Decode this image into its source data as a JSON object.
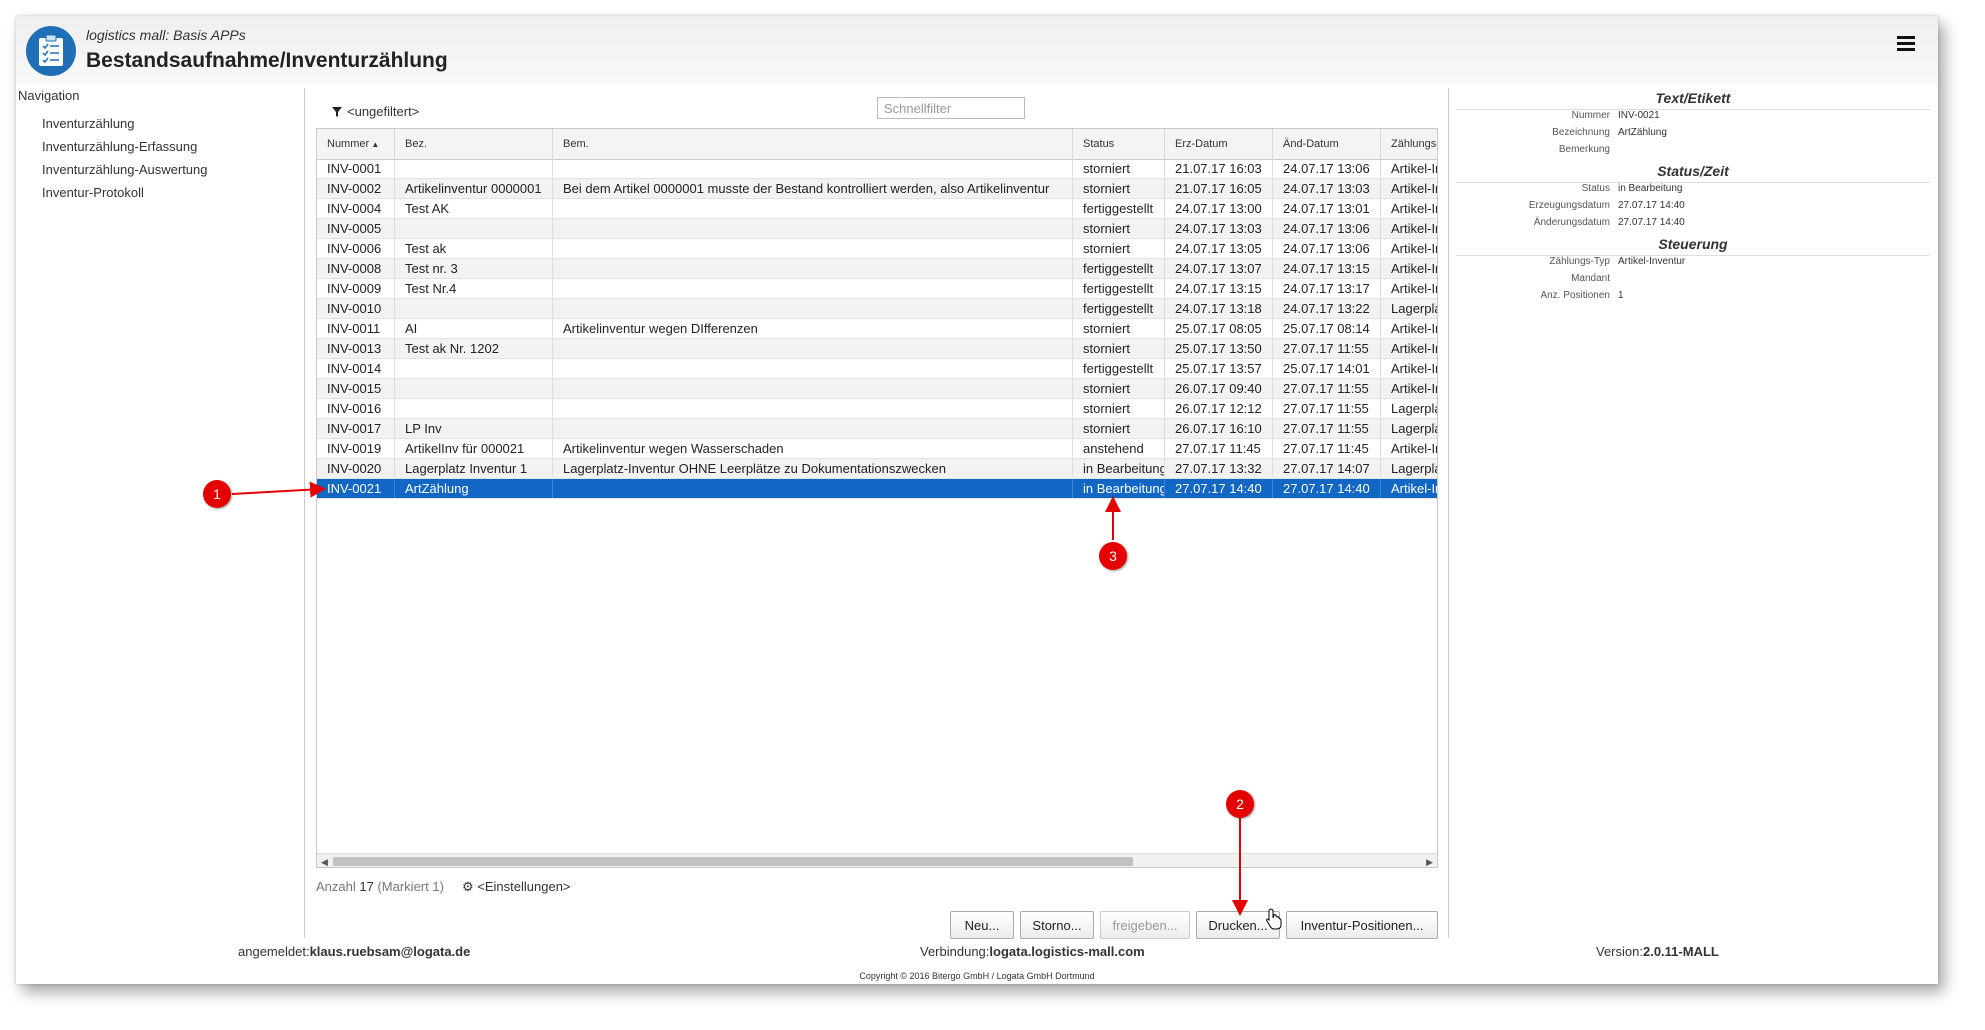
{
  "header": {
    "subtitle": "logistics mall: Basis APPs",
    "title": "Bestandsaufnahme/Inventurzählung"
  },
  "navigation": {
    "title": "Navigation",
    "items": [
      "Inventurzählung",
      "Inventurzählung-Erfassung",
      "Inventurzählung-Auswertung",
      "Inventur-Protokoll"
    ]
  },
  "toolbar": {
    "filter_label": "<ungefiltert>",
    "quickfilter_placeholder": "Schnellfilter"
  },
  "grid": {
    "columns": [
      "Nummer",
      "Bez.",
      "Bem.",
      "Status",
      "Erz-Datum",
      "Änd-Datum",
      "Zählungs-Typ"
    ],
    "sort_column": "Nummer",
    "rows": [
      [
        "INV-0001",
        "",
        "",
        "storniert",
        "21.07.17 16:03",
        "24.07.17 13:06",
        "Artikel-Inventur"
      ],
      [
        "INV-0002",
        "Artikelinventur 0000001",
        "Bei dem Artikel 0000001 musste der Bestand kontrolliert werden, also Artikelinventur",
        "storniert",
        "21.07.17 16:05",
        "24.07.17 13:03",
        "Artikel-Inventur"
      ],
      [
        "INV-0004",
        "Test AK",
        "",
        "fertiggestellt",
        "24.07.17 13:00",
        "24.07.17 13:01",
        "Artikel-Inventur"
      ],
      [
        "INV-0005",
        "",
        "",
        "storniert",
        "24.07.17 13:03",
        "24.07.17 13:06",
        "Artikel-Inventur"
      ],
      [
        "INV-0006",
        "Test ak",
        "",
        "storniert",
        "24.07.17 13:05",
        "24.07.17 13:06",
        "Artikel-Inventur"
      ],
      [
        "INV-0008",
        "Test nr. 3",
        "",
        "fertiggestellt",
        "24.07.17 13:07",
        "24.07.17 13:15",
        "Artikel-Inventur"
      ],
      [
        "INV-0009",
        "Test Nr.4",
        "",
        "fertiggestellt",
        "24.07.17 13:15",
        "24.07.17 13:17",
        "Artikel-Inventur"
      ],
      [
        "INV-0010",
        "",
        "",
        "fertiggestellt",
        "24.07.17 13:18",
        "24.07.17 13:22",
        "Lagerplatz-Inventur"
      ],
      [
        "INV-0011",
        "AI",
        "Artikelinventur wegen DIfferenzen",
        "storniert",
        "25.07.17 08:05",
        "25.07.17 08:14",
        "Artikel-Inventur"
      ],
      [
        "INV-0013",
        "Test ak Nr. 1202",
        "",
        "storniert",
        "25.07.17 13:50",
        "27.07.17 11:55",
        "Artikel-Inventur"
      ],
      [
        "INV-0014",
        "",
        "",
        "fertiggestellt",
        "25.07.17 13:57",
        "25.07.17 14:01",
        "Artikel-Inventur"
      ],
      [
        "INV-0015",
        "",
        "",
        "storniert",
        "26.07.17 09:40",
        "27.07.17 11:55",
        "Artikel-Inventur"
      ],
      [
        "INV-0016",
        "",
        "",
        "storniert",
        "26.07.17 12:12",
        "27.07.17 11:55",
        "Lagerplatz-Inventur"
      ],
      [
        "INV-0017",
        "LP Inv",
        "",
        "storniert",
        "26.07.17 16:10",
        "27.07.17 11:55",
        "Lagerplatz-Inventur"
      ],
      [
        "INV-0019",
        "ArtikelInv für 000021",
        "Artikelinventur wegen Wasserschaden",
        "anstehend",
        "27.07.17 11:45",
        "27.07.17 11:45",
        "Artikel-Inventur"
      ],
      [
        "INV-0020",
        "Lagerplatz Inventur 1",
        "Lagerplatz-Inventur OHNE Leerplätze zu Dokumentationszwecken",
        "in Bearbeitung",
        "27.07.17 13:32",
        "27.07.17 14:07",
        "Lagerplatz-Inventur"
      ],
      [
        "INV-0021",
        "ArtZählung",
        "",
        "in Bearbeitung",
        "27.07.17 14:40",
        "27.07.17 14:40",
        "Artikel-Inventur"
      ]
    ],
    "selected_row_index": 16
  },
  "footer": {
    "count_label": "Anzahl",
    "count_value": "17",
    "marked_text": "(Markiert 1)",
    "settings_label": "<Einstellungen>"
  },
  "buttons": {
    "new": "Neu...",
    "cancel": "Storno...",
    "release": "freigeben...",
    "print": "Drucken...",
    "positions": "Inventur-Positionen..."
  },
  "status_bar": {
    "logged_in_label": "angemeldet:",
    "logged_in_user": "klaus.ruebsam@logata.de",
    "connection_label": "Verbindung:",
    "connection_value": "logata.logistics-mall.com",
    "version_label": "Version:",
    "version_value": "2.0.11-MALL"
  },
  "copyright": "Copyright © 2016 Bitergo GmbH / Logata GmbH Dortmund",
  "details": {
    "text_section": "Text/Etikett",
    "nummer_label": "Nummer",
    "nummer_value": "INV-0021",
    "bezeichnung_label": "Bezeichnung",
    "bezeichnung_value": "ArtZählung",
    "bemerkung_label": "Bemerkung",
    "status_section": "Status/Zeit",
    "status_label": "Status",
    "status_value": "in Bearbeitung",
    "erzeugung_label": "Erzeugungsdatum",
    "erzeugung_value": "27.07.17 14:40",
    "aenderung_label": "Änderungsdatum",
    "aenderung_value": "27.07.17 14:40",
    "steuerung_section": "Steuerung",
    "typ_label": "Zählungs-Typ",
    "typ_value": "Artikel-Inventur",
    "mandant_label": "Mandant",
    "positionen_label": "Anz. Positionen",
    "positionen_value": "1"
  },
  "callouts": [
    "1",
    "2",
    "3"
  ],
  "colors": {
    "selection": "#1267c4",
    "callout": "#e40000",
    "logo": "#1f6fb6"
  }
}
